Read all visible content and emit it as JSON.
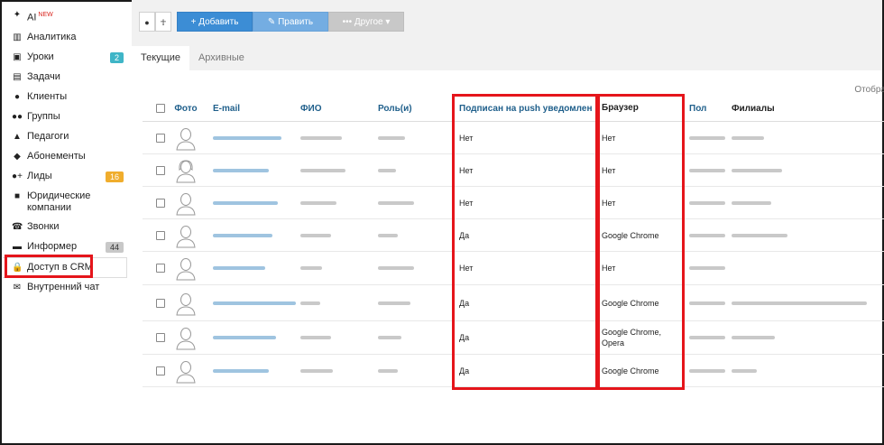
{
  "sidebar": {
    "items": [
      {
        "name": "ai",
        "icon": "sparkle-icon",
        "glyph": "✦",
        "label": "AI",
        "sup": "NEW"
      },
      {
        "name": "analytics",
        "icon": "map-icon",
        "glyph": "▥",
        "label": "Аналитика"
      },
      {
        "name": "lessons",
        "icon": "calendar-icon",
        "glyph": "▣",
        "label": "Уроки",
        "badge": "2",
        "badge_color": "teal"
      },
      {
        "name": "tasks",
        "icon": "clipboard-icon",
        "glyph": "▤",
        "label": "Задачи"
      },
      {
        "name": "clients",
        "icon": "user-icon",
        "glyph": "●",
        "label": "Клиенты"
      },
      {
        "name": "groups",
        "icon": "users-icon",
        "glyph": "●●",
        "label": "Группы"
      },
      {
        "name": "teachers",
        "icon": "graduation-cap-icon",
        "glyph": "▲",
        "label": "Педагоги"
      },
      {
        "name": "subscriptions",
        "icon": "tag-icon",
        "glyph": "◆",
        "label": "Абонементы"
      },
      {
        "name": "leads",
        "icon": "user-plus-icon",
        "glyph": "●+",
        "label": "Лиды",
        "badge": "16",
        "badge_color": "orange"
      },
      {
        "name": "legal",
        "icon": "briefcase-icon",
        "glyph": "■",
        "label": "Юридические компании"
      },
      {
        "name": "calls",
        "icon": "phone-icon",
        "glyph": "☎",
        "label": "Звонки"
      },
      {
        "name": "informer",
        "icon": "newspaper-icon",
        "glyph": "▬",
        "label": "Информер",
        "badge": "44",
        "badge_color": "grey"
      },
      {
        "name": "crm-access",
        "icon": "lock-icon",
        "glyph": "🔒",
        "label": "Доступ в CRM",
        "active": true
      },
      {
        "name": "chat",
        "icon": "envelope-icon",
        "glyph": "✉",
        "label": "Внутренний чат"
      }
    ]
  },
  "toolbar": {
    "add_label": "+ Добавить",
    "edit_label": "✎ Править",
    "other_label": "••• Другое ▾"
  },
  "tabs": [
    {
      "label": "Текущие",
      "active": true
    },
    {
      "label": "Архивные",
      "active": false
    }
  ],
  "display_label": "Отобра",
  "table": {
    "headers": {
      "foto": "Фото",
      "email": "E-mail",
      "fio": "ФИО",
      "role": "Роль(и)",
      "push": "Подписан на push уведомления",
      "browser": "Браузер",
      "gender": "Пол",
      "branches": "Филиалы"
    },
    "rows": [
      {
        "push": "Нет",
        "browser": "Нет",
        "avatar": "male",
        "height": 36
      },
      {
        "push": "Нет",
        "browser": "Нет",
        "avatar": "female",
        "height": 36
      },
      {
        "push": "Нет",
        "browser": "Нет",
        "avatar": "male",
        "height": 36
      },
      {
        "push": "Да",
        "browser": "Google Chrome",
        "avatar": "male",
        "height": 36
      },
      {
        "push": "Нет",
        "browser": "Нет",
        "avatar": "male",
        "height": 37
      },
      {
        "push": "Да",
        "browser": "Google Chrome",
        "avatar": "male",
        "height": 40
      },
      {
        "push": "Да",
        "browser": "Google Chrome, Opera",
        "avatar": "male",
        "height": 37
      },
      {
        "push": "Да",
        "browser": "Google Chrome",
        "avatar": "male",
        "height": 36
      }
    ]
  }
}
